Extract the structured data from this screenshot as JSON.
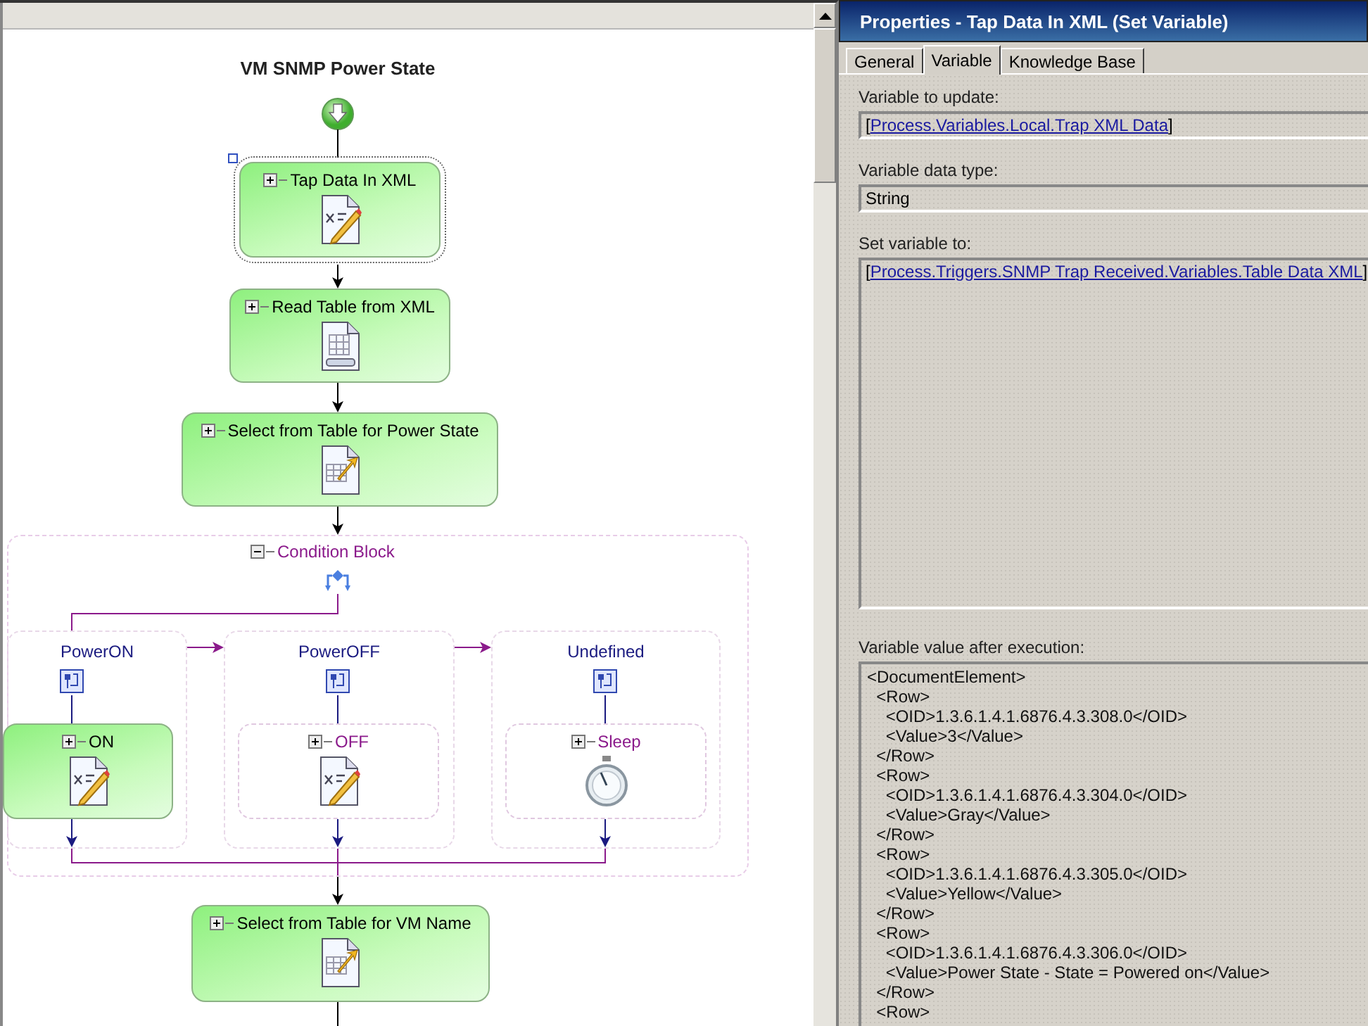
{
  "diagram": {
    "title": "VM SNMP Power State",
    "activities": [
      {
        "label": "Tap Data In XML",
        "kind": "set_variable",
        "selected": true,
        "expanded": false,
        "executed": true
      },
      {
        "label": "Read Table from XML",
        "kind": "read_table",
        "selected": false,
        "expanded": false,
        "executed": true
      },
      {
        "label": "Select from Table for Power State",
        "kind": "select_table",
        "selected": false,
        "expanded": false,
        "executed": true
      }
    ],
    "condition_block": {
      "label": "Condition Block",
      "expanded": true,
      "branches": [
        {
          "label": "PowerON",
          "activity": {
            "label": "ON",
            "kind": "set_variable",
            "selected": false,
            "expanded": false,
            "executed": true
          }
        },
        {
          "label": "PowerOFF",
          "activity": {
            "label": "OFF",
            "kind": "set_variable",
            "selected": false,
            "expanded": false,
            "executed": false
          }
        },
        {
          "label": "Undefined",
          "activity": {
            "label": "Sleep",
            "kind": "sleep",
            "selected": false,
            "expanded": false,
            "executed": false
          }
        }
      ]
    },
    "after": [
      {
        "label": "Select from Table for VM Name",
        "kind": "select_table",
        "selected": false,
        "expanded": false,
        "executed": true
      }
    ]
  },
  "properties": {
    "title": "Properties - Tap Data In XML (Set Variable)",
    "tabs": [
      {
        "label": "General",
        "selected": false
      },
      {
        "label": "Variable",
        "selected": true
      },
      {
        "label": "Knowledge Base",
        "selected": false
      }
    ],
    "fields": [
      {
        "label": "Variable to update:",
        "prefix": "[",
        "value": "Process.Variables.Local.Trap XML Data",
        "suffix": "]",
        "kind": "link"
      },
      {
        "label": "Variable data type:",
        "value": "String",
        "kind": "text"
      },
      {
        "label": "Set variable to:",
        "prefix": "[",
        "value": "Process.Triggers.SNMP Trap Received.Variables.Table Data XML",
        "suffix": "]",
        "kind": "link_area"
      }
    ],
    "result": {
      "label": "Variable value after execution:",
      "lines": [
        "<DocumentElement>",
        "  <Row>",
        "    <OID>1.3.6.1.4.1.6876.4.3.308.0</OID>",
        "    <Value>3</Value>",
        "  </Row>",
        "  <Row>",
        "    <OID>1.3.6.1.4.1.6876.4.3.304.0</OID>",
        "    <Value>Gray</Value>",
        "  </Row>",
        "  <Row>",
        "    <OID>1.3.6.1.4.1.6876.4.3.305.0</OID>",
        "    <Value>Yellow</Value>",
        "  </Row>",
        "  <Row>",
        "    <OID>1.3.6.1.4.1.6876.4.3.306.0</OID>",
        "    <Value>Power State - State = Powered on</Value>",
        "  </Row>",
        "  <Row>"
      ]
    }
  }
}
